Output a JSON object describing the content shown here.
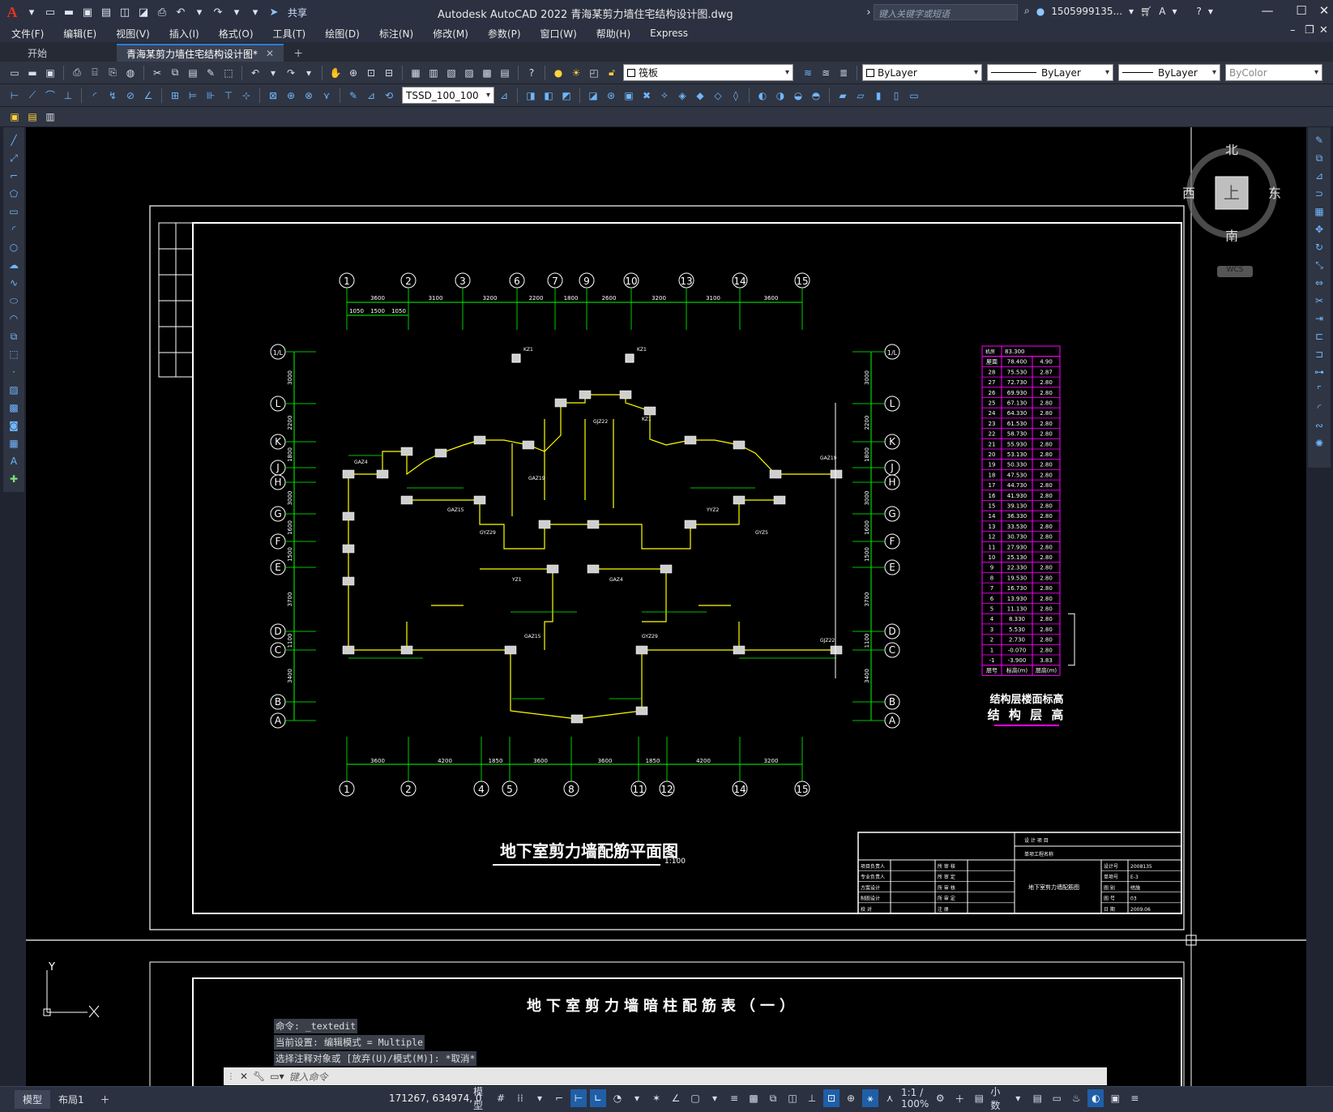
{
  "app": {
    "logo": "A",
    "title": "Autodesk AutoCAD 2022    青海某剪力墙住宅结构设计图.dwg",
    "share_label": "共享",
    "search_placeholder": "键入关键字或短语",
    "user": "1505999135...",
    "colors": {
      "accent": "#2e7bd6",
      "drawing_bg": "#000000",
      "cad_white": "#ffffff",
      "cad_green": "#00ff00",
      "cad_magenta": "#ff00ff",
      "cad_yellow": "#ffff00"
    }
  },
  "menu": [
    "文件(F)",
    "编辑(E)",
    "视图(V)",
    "插入(I)",
    "格式(O)",
    "工具(T)",
    "绘图(D)",
    "标注(N)",
    "修改(M)",
    "参数(P)",
    "窗口(W)",
    "帮助(H)",
    "Express"
  ],
  "tabs": [
    {
      "label": "开始"
    },
    {
      "label": "青海某剪力墙住宅结构设计图*"
    }
  ],
  "toolbar": {
    "layer_name": "筏板",
    "color": "ByLayer",
    "linetype": "ByLayer",
    "lineweight": "ByLayer",
    "plotstyle": "ByColor",
    "dimstyle": "TSSD_100_100"
  },
  "viewcube": {
    "north": "北",
    "south": "南",
    "east": "东",
    "west": "西",
    "top": "上",
    "wcs": "WCS"
  },
  "drawing": {
    "title": "地下室剪力墙配筋平面图",
    "scale": "1:100",
    "next_title": "地下室剪力墙暗柱配筋表（一）",
    "axes_top": [
      "1",
      "2",
      "3",
      "6",
      "7",
      "9",
      "10",
      "13",
      "14",
      "15"
    ],
    "dims_top": [
      "3600",
      "3100",
      "3200",
      "2200",
      "1800",
      "2600",
      "3200",
      "3100",
      "3600"
    ],
    "dims_top_sub": [
      "1050",
      "1500",
      "1050"
    ],
    "axes_bottom": [
      "1",
      "2",
      "4",
      "5",
      "8",
      "11",
      "12",
      "14",
      "15"
    ],
    "dims_bottom": [
      "3600",
      "4200",
      "1850",
      "3600",
      "3600",
      "1850",
      "4200",
      "3200"
    ],
    "axes_left": [
      "1/L",
      "L",
      "K",
      "J",
      "H",
      "G",
      "F",
      "E",
      "D",
      "C",
      "B",
      "A"
    ],
    "dims_left": [
      "3000",
      "2200",
      "1800",
      "3000",
      "1600",
      "1500",
      "3700",
      "1100",
      "3400"
    ],
    "table_title1": "结构层楼面标高",
    "table_title2": "结 构 层 高",
    "table_header": [
      "层号",
      "标高(m)",
      "层高(m)"
    ],
    "table_top": [
      "机房",
      "83.300"
    ],
    "table_rows": [
      [
        "屋面",
        "78.400",
        "4.90"
      ],
      [
        "28",
        "75.530",
        "2.87"
      ],
      [
        "27",
        "72.730",
        "2.80"
      ],
      [
        "26",
        "69.930",
        "2.80"
      ],
      [
        "25",
        "67.130",
        "2.80"
      ],
      [
        "24",
        "64.330",
        "2.80"
      ],
      [
        "23",
        "61.530",
        "2.80"
      ],
      [
        "22",
        "58.730",
        "2.80"
      ],
      [
        "21",
        "55.930",
        "2.80"
      ],
      [
        "20",
        "53.130",
        "2.80"
      ],
      [
        "19",
        "50.330",
        "2.80"
      ],
      [
        "18",
        "47.530",
        "2.80"
      ],
      [
        "17",
        "44.730",
        "2.80"
      ],
      [
        "16",
        "41.930",
        "2.80"
      ],
      [
        "15",
        "39.130",
        "2.80"
      ],
      [
        "14",
        "36.330",
        "2.80"
      ],
      [
        "13",
        "33.530",
        "2.80"
      ],
      [
        "12",
        "30.730",
        "2.80"
      ],
      [
        "11",
        "27.930",
        "2.80"
      ],
      [
        "10",
        "25.130",
        "2.80"
      ],
      [
        "9",
        "22.330",
        "2.80"
      ],
      [
        "8",
        "19.530",
        "2.80"
      ],
      [
        "7",
        "16.730",
        "2.80"
      ],
      [
        "6",
        "13.930",
        "2.80"
      ],
      [
        "5",
        "11.130",
        "2.80"
      ],
      [
        "4",
        "8.330",
        "2.80"
      ],
      [
        "3",
        "5.530",
        "2.80"
      ],
      [
        "2",
        "2.730",
        "2.80"
      ],
      [
        "1",
        "-0.070",
        "2.80"
      ],
      [
        "-1",
        "-3.900",
        "3.83"
      ]
    ],
    "titleblock": {
      "project": "设 计 项 目",
      "sub": "单项工程名称",
      "name": "地下室剪力墙配筋图",
      "left_labels": [
        "项目负责人",
        "专业负责人",
        "方案设计",
        "制图设计",
        "校    对"
      ],
      "mid_labels": [
        "所 审 核",
        "所 审 定",
        "所 审 核",
        "所 审 定",
        "注    册"
      ],
      "right_labels": [
        "设计号",
        "单项号",
        "图   别",
        "图   号",
        "日   期"
      ],
      "right_values": [
        "2008135",
        "E-3",
        "结施",
        "03",
        "2009.06"
      ]
    },
    "notes": [
      "GAZ4",
      "GAZ15",
      "GYZ29",
      "GAZ19",
      "GJZ22",
      "KZ1",
      "YYZ2",
      "GYZ5",
      "YZ1"
    ]
  },
  "command": {
    "history": [
      "命令: _textedit",
      "当前设置: 编辑模式 = Multiple",
      "选择注释对象或 [放弃(U)/模式(M)]: *取消*"
    ],
    "placeholder": "键入命令"
  },
  "status": {
    "layout_tabs": [
      "模型",
      "布局1"
    ],
    "coords": "171267, 634974, 0",
    "mode": "模型",
    "scale": "1:1 / 100%",
    "units": "小数"
  },
  "ucs": {
    "y": "Y"
  }
}
